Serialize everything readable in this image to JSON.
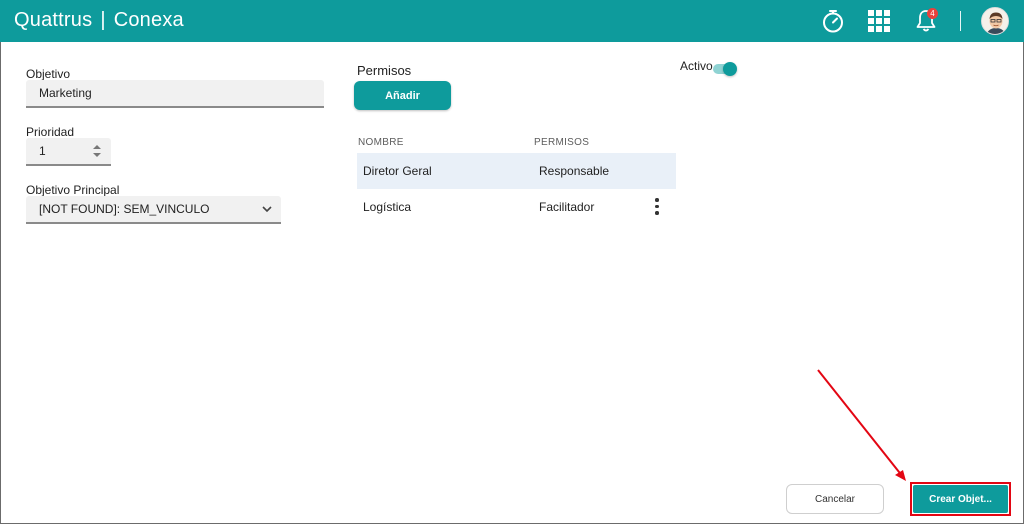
{
  "header": {
    "brand_left": "Quattrus",
    "brand_separator": "|",
    "brand_right": "Conexa",
    "notifications_count": "4",
    "icons": [
      "stopwatch-icon",
      "apps-grid-icon",
      "bell-icon",
      "user-avatar"
    ]
  },
  "form": {
    "objetivo_label": "Objetivo",
    "objetivo_value": "Marketing",
    "prioridad_label": "Prioridad",
    "prioridad_value": "1",
    "principal_label": "Objetivo Principal",
    "principal_value": "[NOT FOUND]: SEM_VINCULO"
  },
  "permisos": {
    "title": "Permisos",
    "add_label": "Añadir",
    "columns": [
      "NOMBRE",
      "PERMISOS"
    ],
    "rows": [
      {
        "nombre": "Diretor Geral",
        "permiso": "Responsable"
      },
      {
        "nombre": "Logística",
        "permiso": "Facilitador"
      }
    ]
  },
  "activo": {
    "label": "Activo",
    "enabled": true
  },
  "footer": {
    "cancel_label": "Cancelar",
    "create_label": "Crear Objet..."
  },
  "colors": {
    "accent": "#0e9b9c",
    "highlight": "#e30613",
    "row_highlight": "#e9f0f8"
  }
}
